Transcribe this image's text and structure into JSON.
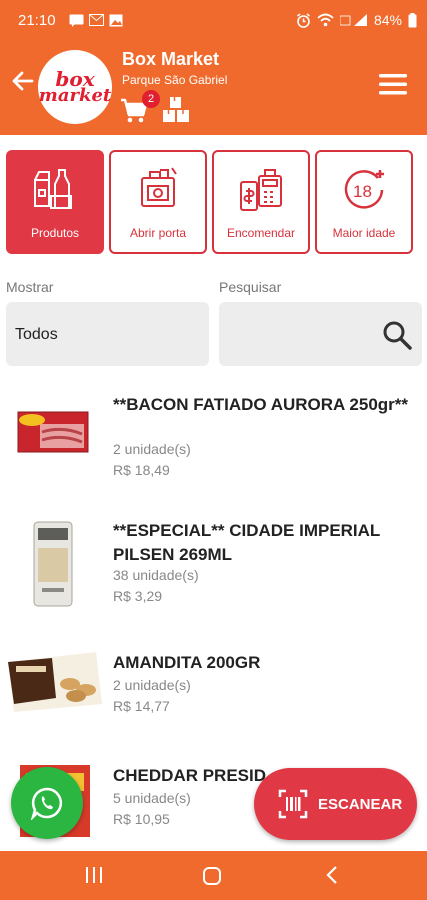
{
  "status_bar": {
    "time": "21:10",
    "battery": "84%"
  },
  "header": {
    "store_name": "Box Market",
    "location": "Parque São Gabriel",
    "cart_count": "2",
    "logo_line1": "box",
    "logo_line2": "market"
  },
  "tiles": [
    {
      "label": "Produtos",
      "active": true
    },
    {
      "label": "Abrir porta",
      "active": false
    },
    {
      "label": "Encomendar",
      "active": false
    },
    {
      "label": "Maior idade",
      "active": false
    }
  ],
  "filters": {
    "show_label": "Mostrar",
    "show_value": "Todos",
    "search_label": "Pesquisar"
  },
  "products": [
    {
      "name": " **BACON FATIADO AURORA 250gr**",
      "qty": "2 unidade(s)",
      "price": "R$ 18,49"
    },
    {
      "name": " **ESPECIAL** CIDADE IMPERIAL PILSEN 269ML",
      "qty": "38 unidade(s)",
      "price": "R$ 3,29"
    },
    {
      "name": " AMANDITA 200GR",
      "qty": "2 unidade(s)",
      "price": "R$ 14,77"
    },
    {
      "name": " CHEDDAR PRESID",
      "qty": "5 unidade(s)",
      "price": "R$ 10,95"
    }
  ],
  "scan_button": {
    "label": "ESCANEAR"
  },
  "colors": {
    "orange": "#ef6a2c",
    "red": "#e13845",
    "green": "#2bb541"
  }
}
